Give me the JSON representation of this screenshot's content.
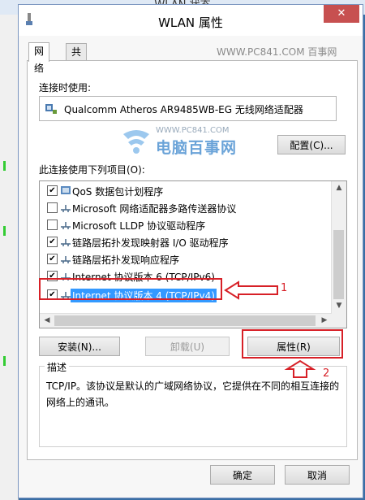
{
  "background_window": {
    "title": "WLAN 状态"
  },
  "dialog": {
    "title": "WLAN 属性",
    "close_label": "✕"
  },
  "tabs": [
    {
      "label": "网络",
      "active": true
    },
    {
      "label": "共享",
      "active": false
    }
  ],
  "watermark": {
    "site": "WWW.PC841.COM 百事网",
    "logo_url": "WWW.PC841.COM",
    "logo_name": "电脑百事网"
  },
  "connect_label": "连接时使用:",
  "adapter_name": "Qualcomm Atheros AR9485WB-EG 无线网络适配器",
  "configure_button": "配置(C)...",
  "items_label": "此连接使用下列项目(O):",
  "items": [
    {
      "label": "QoS 数据包计划程序",
      "checked": true,
      "icon": "qos-icon"
    },
    {
      "label": "Microsoft 网络适配器多路传送器协议",
      "checked": false,
      "icon": "protocol-icon"
    },
    {
      "label": "Microsoft LLDP 协议驱动程序",
      "checked": false,
      "icon": "protocol-icon"
    },
    {
      "label": "链路层拓扑发现映射器 I/O 驱动程序",
      "checked": true,
      "icon": "protocol-icon"
    },
    {
      "label": "链路层拓扑发现响应程序",
      "checked": true,
      "icon": "protocol-icon"
    },
    {
      "label": "Internet 协议版本 6 (TCP/IPv6)",
      "checked": true,
      "icon": "protocol-icon"
    },
    {
      "label": "Internet 协议版本 4 (TCP/IPv4)",
      "checked": true,
      "icon": "protocol-icon",
      "selected": true
    }
  ],
  "buttons": {
    "install": "安装(N)...",
    "uninstall": "卸载(U)",
    "properties": "属性(R)"
  },
  "description": {
    "legend": "描述",
    "text": "TCP/IP。该协议是默认的广域网络协议，它提供在不同的相互连接的网络上的通讯。"
  },
  "annotations": {
    "one": "1",
    "two": "2"
  },
  "footer": {
    "ok": "确定",
    "cancel": "取消"
  },
  "colors": {
    "accent_red": "#d72027",
    "selection_blue": "#3399ff"
  }
}
